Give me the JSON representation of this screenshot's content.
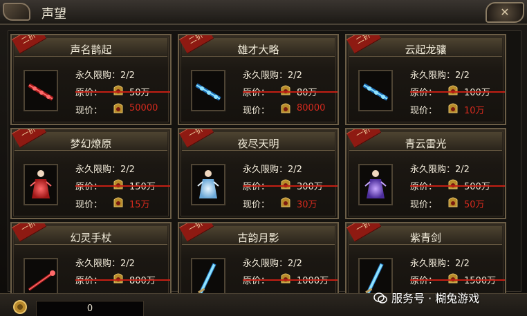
{
  "window": {
    "title": "声望"
  },
  "items": [
    {
      "name": "声名鹊起",
      "discount": "二折",
      "limit_label": "永久限购：2/2",
      "original_label": "原价：",
      "original_price": "50万",
      "current_label": "现价：",
      "current_price": "50000",
      "icon": "red-glowing-weapon-icon"
    },
    {
      "name": "雄才大略",
      "discount": "二折",
      "limit_label": "永久限购：2/2",
      "original_label": "原价：",
      "original_price": "80万",
      "current_label": "现价：",
      "current_price": "80000",
      "icon": "blue-glowing-weapon-icon"
    },
    {
      "name": "云起龙骧",
      "discount": "二折",
      "limit_label": "永久限购：2/2",
      "original_label": "原价：",
      "original_price": "100万",
      "current_label": "现价：",
      "current_price": "10万",
      "icon": "blue-dragon-weapon-icon"
    },
    {
      "name": "梦幻燎原",
      "discount": "一折",
      "limit_label": "永久限购：2/2",
      "original_label": "原价：",
      "original_price": "150万",
      "current_label": "现价：",
      "current_price": "15万",
      "icon": "red-robe-figure-icon"
    },
    {
      "name": "夜尽天明",
      "discount": "一折",
      "limit_label": "永久限购：2/2",
      "original_label": "原价：",
      "original_price": "300万",
      "current_label": "现价：",
      "current_price": "30万",
      "icon": "white-robe-figure-icon"
    },
    {
      "name": "青云雷光",
      "discount": "一折",
      "limit_label": "永久限购：2/2",
      "original_label": "原价：",
      "original_price": "500万",
      "current_label": "现价：",
      "current_price": "50万",
      "icon": "purple-robe-figure-icon"
    },
    {
      "name": "幻灵手杖",
      "discount": "一折",
      "limit_label": "永久限购：2/2",
      "original_label": "原价：",
      "original_price": "800万",
      "current_label": "",
      "current_price": "",
      "icon": "red-staff-icon"
    },
    {
      "name": "古韵月影",
      "discount": "一折",
      "limit_label": "永久限购：2/2",
      "original_label": "原价：",
      "original_price": "1000万",
      "current_label": "",
      "current_price": "",
      "icon": "blue-sword-icon"
    },
    {
      "name": "紫青剑",
      "discount": "一折",
      "limit_label": "永久限购：2/2",
      "original_label": "原价：",
      "original_price": "1500万",
      "current_label": "",
      "current_price": "",
      "icon": "blue-blade-icon"
    }
  ],
  "footer": {
    "currency_value": "0",
    "watermark": "服务号 · 糊兔游戏"
  },
  "colors": {
    "price_red": "#d62a1e",
    "strike_red": "#c41f14",
    "frame_gold": "#6c5e47"
  }
}
